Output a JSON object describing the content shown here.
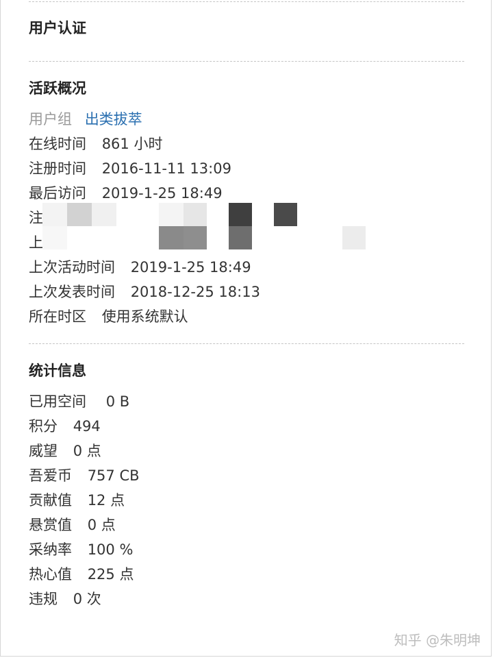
{
  "sections": {
    "user_auth": {
      "title": "用户认证"
    },
    "activity": {
      "title": "活跃概况",
      "user_group": {
        "label": "用户组",
        "value": "出类拔萃"
      },
      "online_time": {
        "label": "在线时间",
        "value": "861 小时"
      },
      "register_time": {
        "label": "注册时间",
        "value": "2016-11-11 13:09"
      },
      "last_visit": {
        "label": "最后访问",
        "value": "2019-1-25 18:49"
      },
      "redacted_row_1": {
        "label_start": "注"
      },
      "redacted_row_2": {
        "label_start": "上"
      },
      "last_activity": {
        "label": "上次活动时间",
        "value": "2019-1-25 18:49"
      },
      "last_post": {
        "label": "上次发表时间",
        "value": "2018-12-25 18:13"
      },
      "timezone": {
        "label": "所在时区",
        "value": "使用系统默认"
      }
    },
    "stats": {
      "title": "统计信息",
      "items": [
        {
          "label": "已用空间",
          "value": "0 B"
        },
        {
          "label": "积分",
          "value": "494"
        },
        {
          "label": "威望",
          "value": "0 点"
        },
        {
          "label": "吾爱币",
          "value": "757 CB"
        },
        {
          "label": "贡献值",
          "value": "12 点"
        },
        {
          "label": "悬赏值",
          "value": "0 点"
        },
        {
          "label": "采纳率",
          "value": "100 %"
        },
        {
          "label": "热心值",
          "value": "225 点"
        },
        {
          "label": "违规",
          "value": "0 次"
        }
      ]
    }
  },
  "watermark": "知乎 @朱明坤",
  "colors": {
    "link": "#2a6fb0",
    "muted": "#9a9a9a",
    "text": "#333333",
    "divider": "#c4c4c4"
  }
}
